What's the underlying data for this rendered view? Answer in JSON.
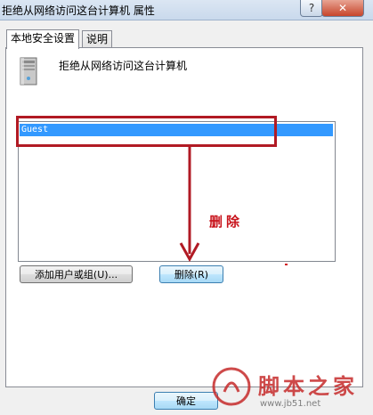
{
  "window": {
    "title": "拒绝从网络访问这台计算机 属性",
    "help_glyph": "?",
    "close_glyph": "✕"
  },
  "tabs": [
    {
      "label": "本地安全设置",
      "active": true
    },
    {
      "label": "说明",
      "active": false
    }
  ],
  "policy": {
    "title": "拒绝从网络访问这台计算机",
    "icon": "computer-icon"
  },
  "list": {
    "items": [
      "Guest"
    ],
    "selected": "Guest"
  },
  "annotation": {
    "text": "删除",
    "color": "#c8141c"
  },
  "buttons": {
    "add_label": "添加用户或组(U)...",
    "remove_label": "删除(R)",
    "ok_label": "确定"
  },
  "watermark": {
    "brand": "脚本之家",
    "url": "www.jb51.net"
  },
  "colors": {
    "selection": "#3399ff",
    "highlight": "#b11a24"
  }
}
